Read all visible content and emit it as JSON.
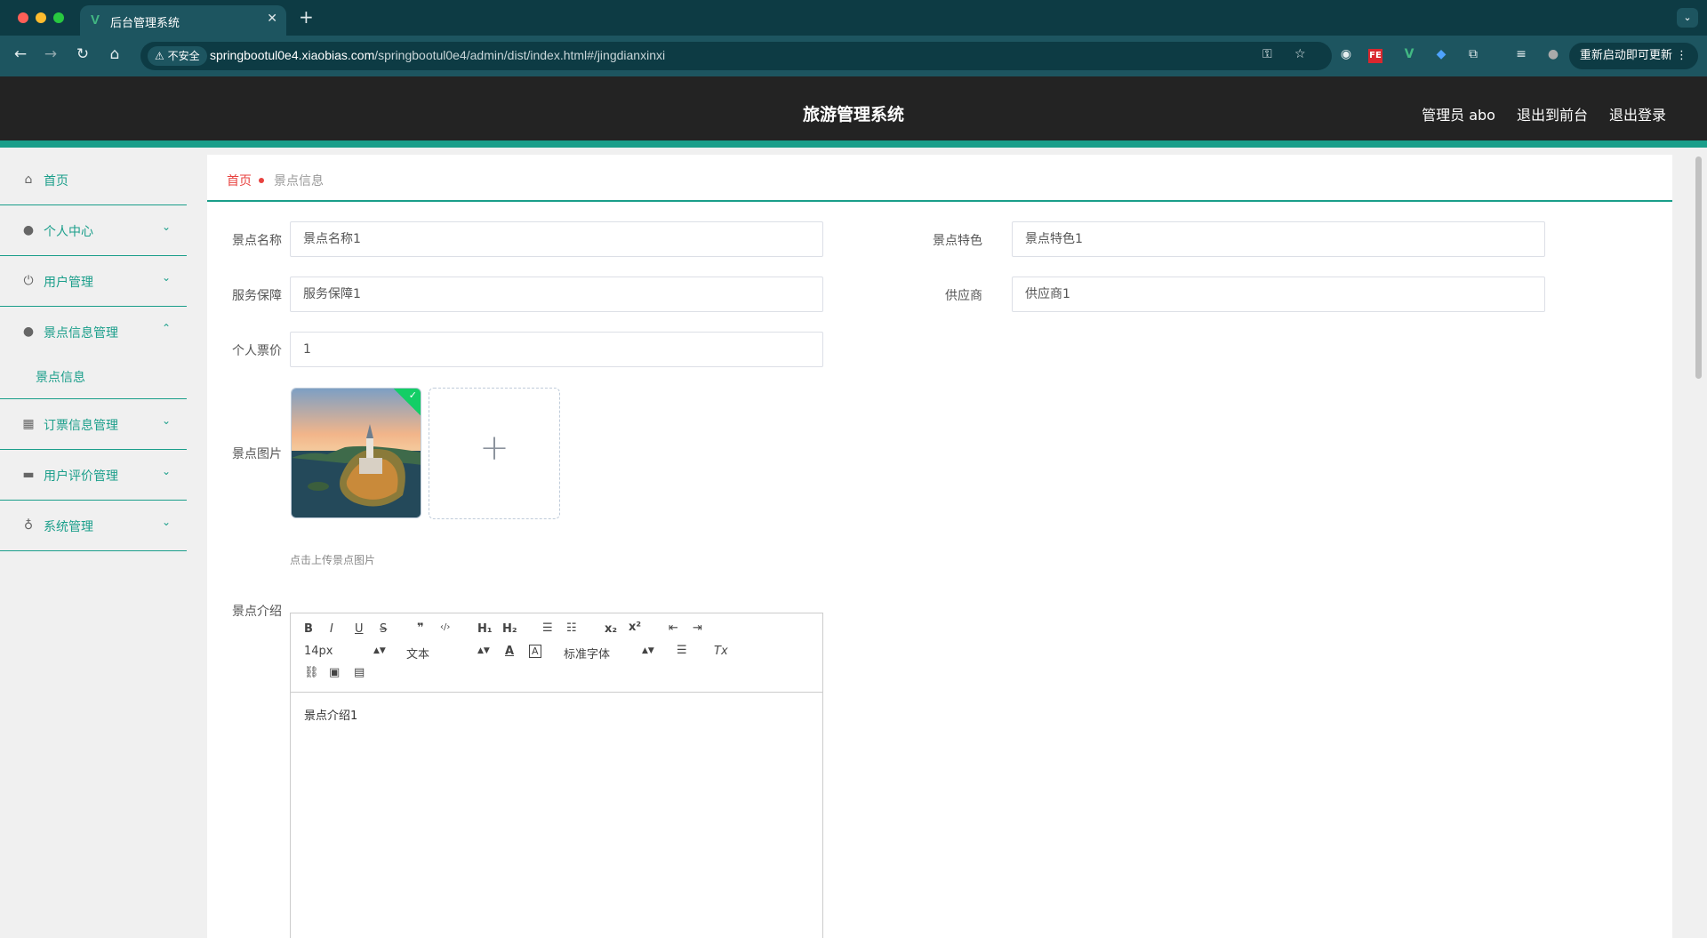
{
  "browser": {
    "tab_title": "后台管理系统",
    "tab_favicon": "V",
    "security_label": "不安全",
    "url_host": "springbootul0e4.xiaobias.com",
    "url_path": "/springbootul0e4/admin/dist/index.html#/jingdianxinxi",
    "update_label": "重新启动即可更新",
    "extension_fe_label": "FE"
  },
  "header": {
    "title": "旅游管理系统",
    "user_label": "管理员 abo",
    "to_front_label": "退出到前台",
    "logout_label": "退出登录"
  },
  "sidebar": {
    "items": [
      {
        "label": "首页",
        "icon": "home-icon"
      },
      {
        "label": "个人中心",
        "icon": "user-icon"
      },
      {
        "label": "用户管理",
        "icon": "power-icon"
      },
      {
        "label": "景点信息管理",
        "icon": "user-icon",
        "open": true,
        "children": [
          "景点信息"
        ]
      },
      {
        "label": "订票信息管理",
        "icon": "grid-icon"
      },
      {
        "label": "用户评价管理",
        "icon": "inbox-icon"
      },
      {
        "label": "系统管理",
        "icon": "mic-icon"
      }
    ]
  },
  "breadcrumb": {
    "home": "首页",
    "current": "景点信息"
  },
  "form": {
    "name_label": "景点名称",
    "name_value": "景点名称1",
    "feature_label": "景点特色",
    "feature_value": "景点特色1",
    "service_label": "服务保障",
    "service_value": "服务保障1",
    "supplier_label": "供应商",
    "supplier_value": "供应商1",
    "price_label": "个人票价",
    "price_value": "1",
    "image_label": "景点图片",
    "image_tip": "点击上传景点图片",
    "intro_label": "景点介绍",
    "intro_content": "景点介绍1"
  },
  "editor": {
    "font_size": "14px",
    "header_select": "文本",
    "font_family": "标准字体",
    "buttons": {
      "bold": "B",
      "italic": "I",
      "underline": "U",
      "strike": "S",
      "blockquote": "❞",
      "code": "‹/›",
      "h1": "H₁",
      "h2": "H₂",
      "ordered_list": "☰",
      "bullet_list": "☷",
      "subscript": "x₂",
      "superscript": "x²",
      "outdent": "⇤",
      "indent": "⇥",
      "color": "A",
      "background": "A",
      "align": "☰",
      "clean": "Tx",
      "link": "⛓",
      "image": "▣",
      "video": "▤"
    }
  },
  "colors": {
    "accent": "#1a9e8a",
    "header_bg": "#232323",
    "breadcrumb_home": "#e8423f",
    "success": "#13ce66"
  }
}
